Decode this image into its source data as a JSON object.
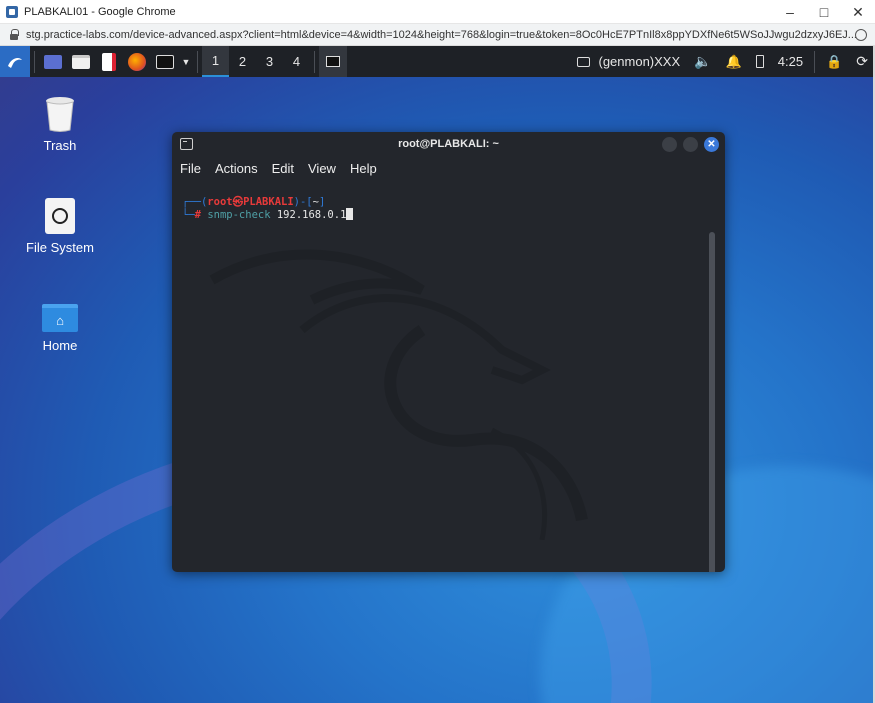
{
  "browser": {
    "window_title": "PLABKALI01 - Google Chrome",
    "address": "stg.practice-labs.com/device-advanced.aspx?client=html&device=4&width=1024&height=768&login=true&token=8Oc0HcE7PTnIl8x8ppYDXfNe6t5WSoJJwgu2dzxyJ6EJ...",
    "minimize": "–",
    "maximize": "□",
    "close": "✕"
  },
  "panel": {
    "workspaces": [
      "1",
      "2",
      "3",
      "4"
    ],
    "active_workspace": "1",
    "genmon": "(genmon)XXX",
    "clock": "4:25"
  },
  "desktop_icons": [
    {
      "label": "Trash",
      "icon": "trash-icon"
    },
    {
      "label": "File System",
      "icon": "drive-icon"
    },
    {
      "label": "Home",
      "icon": "home-folder-icon"
    }
  ],
  "terminal": {
    "title": "root@PLABKALI: ~",
    "menu": [
      "File",
      "Actions",
      "Edit",
      "View",
      "Help"
    ],
    "prompt_user": "root㉿PLABKALI",
    "prompt_dir": "~",
    "prompt_symbol": "#",
    "command": "snmp-check",
    "argument": "192.168.0.1"
  },
  "colors": {
    "panel_bg": "#1e2126",
    "terminal_bg": "#23262c",
    "prompt_red": "#e83a3a",
    "prompt_blue": "#2f7bd8",
    "command_cyan": "#4fa0a6"
  }
}
